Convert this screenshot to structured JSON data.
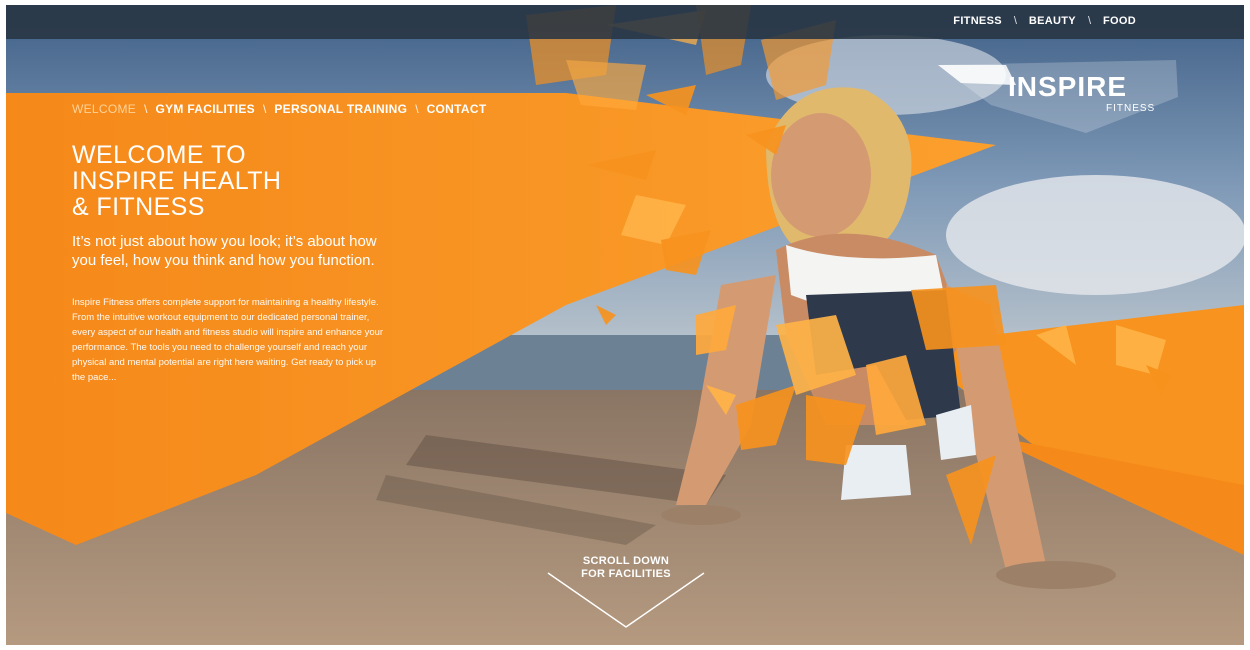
{
  "colors": {
    "accent": "#f7931e",
    "accent_light": "#ffb347",
    "topbar": "#283442",
    "sand": "#a98f78",
    "sky": "#4d6e95"
  },
  "top_nav": {
    "items": [
      "FITNESS",
      "BEAUTY",
      "FOOD"
    ]
  },
  "logo": {
    "main": "INSPIRE",
    "sub": "FITNESS"
  },
  "main_nav": {
    "items": [
      "WELCOME",
      "GYM FACILITIES",
      "PERSONAL TRAINING",
      "CONTACT"
    ],
    "active": "WELCOME"
  },
  "hero": {
    "headline": [
      "WELCOME TO",
      "INSPIRE HEALTH",
      "& FITNESS"
    ],
    "tagline": "It’s not just about how you look; it’s about how you feel, how you think and how you function.",
    "body": "Inspire Fitness offers complete support for maintaining a healthy lifestyle. From the intuitive workout equipment to our dedicated personal trainer, every aspect of our health and fitness studio will inspire and enhance your performance. The tools you need to challenge yourself and reach your physical and mental potential are right here waiting. Get ready to pick up the pace..."
  },
  "scroll_cta": {
    "line1": "SCROLL DOWN",
    "line2": "FOR FACILITIES"
  }
}
